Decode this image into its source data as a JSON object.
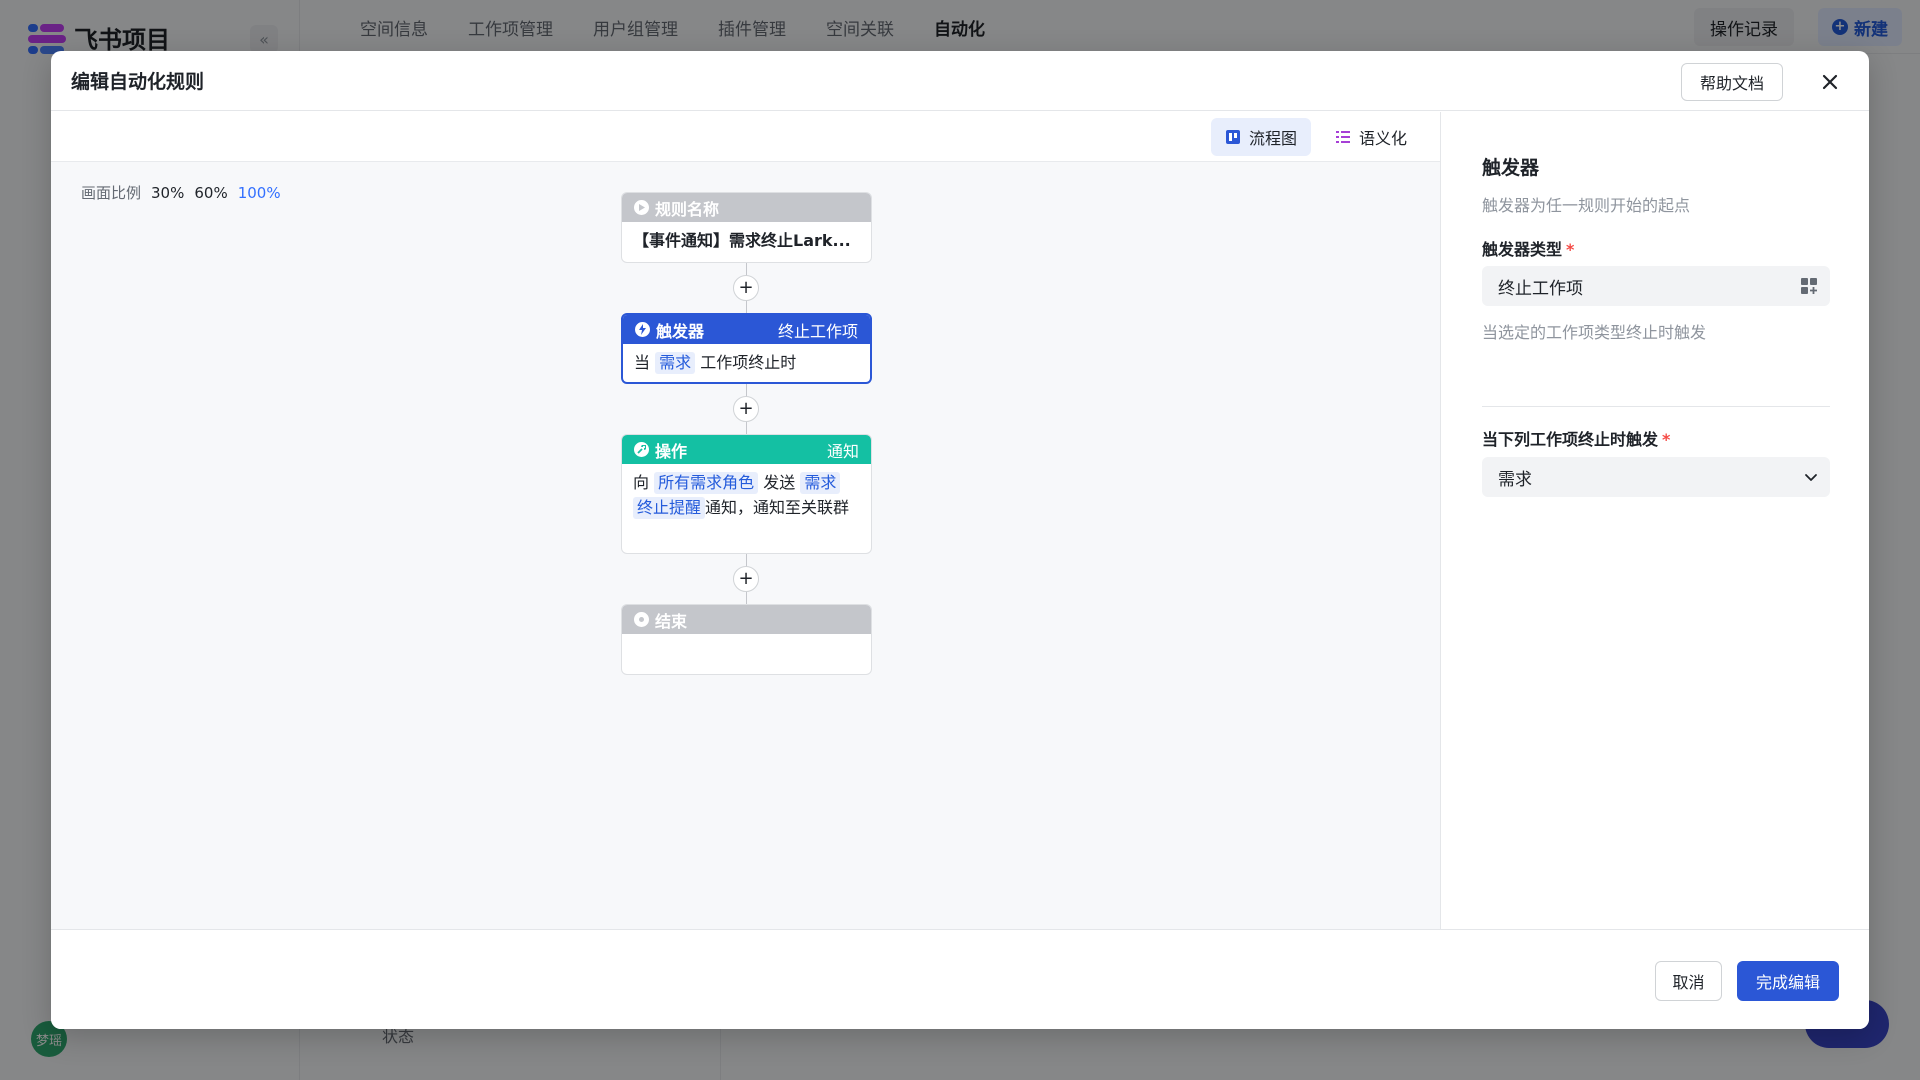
{
  "background": {
    "app_name": "飞书项目",
    "nav_tabs": [
      "空间信息",
      "工作项管理",
      "用户组管理",
      "插件管理",
      "空间关联",
      "自动化"
    ],
    "active_tab": "自动化",
    "oplog_label": "操作记录",
    "new_label": "新建",
    "avatar_text": "梦瑶",
    "state_label": "状态"
  },
  "modal": {
    "title": "编辑自动化规则",
    "help_label": "帮助文档"
  },
  "canvas": {
    "view_flow_label": "流程图",
    "view_semantic_label": "语义化",
    "zoom_label": "画面比例",
    "zoom_options": [
      "30%",
      "60%",
      "100%"
    ],
    "zoom_active": "100%"
  },
  "flow": {
    "rule": {
      "header": "规则名称",
      "body": "【事件通知】需求终止Lark..."
    },
    "trigger": {
      "header": "触发器",
      "type": "终止工作项",
      "prefix": "当",
      "tag": "需求",
      "suffix": "工作项终止时"
    },
    "action": {
      "header": "操作",
      "type": "通知",
      "p1": "向",
      "tag1": "所有需求角色",
      "p2": "发送",
      "tag2": "需求",
      "tag3": "终止提醒",
      "p3": "通知，通知至关联群"
    },
    "end": {
      "header": "结束"
    }
  },
  "panel": {
    "title": "触发器",
    "desc": "触发器为任一规则开始的起点",
    "trigger_type_label": "触发器类型",
    "trigger_type_value": "终止工作项",
    "trigger_type_hint": "当选定的工作项类型终止时触发",
    "when_label": "当下列工作项终止时触发",
    "when_value": "需求"
  },
  "footer": {
    "cancel_label": "取消",
    "done_label": "完成编辑"
  },
  "colors": {
    "primary": "#2b57d6",
    "trigger_header": "#2b57d6",
    "action_header": "#14c0a3",
    "neutral_header": "#c4c6cb",
    "required": "#f54a45"
  }
}
